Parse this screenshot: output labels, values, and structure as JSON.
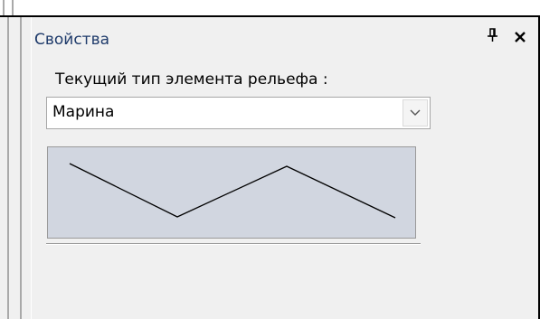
{
  "panel": {
    "title": "Свойства",
    "pin_icon": "pin-icon",
    "close_icon": "close-icon"
  },
  "relief": {
    "label": "Текущий тип элемента рельефа :",
    "selected": "Марина",
    "dropdown_icon": "chevron-down-icon",
    "preview_shape": "zigzag-line"
  },
  "colors": {
    "preview_bg": "#d1d6e0",
    "title_text": "#1f3b6b",
    "panel_bg": "#f0f0f0"
  }
}
